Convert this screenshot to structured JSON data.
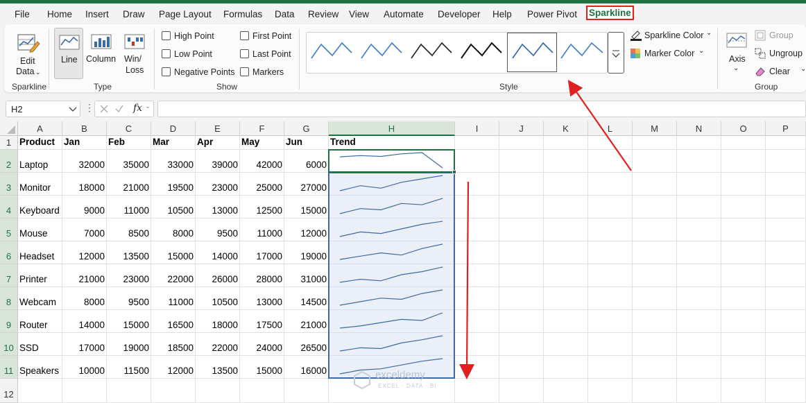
{
  "menu": {
    "tabs": [
      "File",
      "Home",
      "Insert",
      "Draw",
      "Page Layout",
      "Formulas",
      "Data",
      "Review",
      "View",
      "Automate",
      "Developer",
      "Help",
      "Power Pivot",
      "Sparkline"
    ],
    "active_tab": "Sparkline"
  },
  "ribbon": {
    "sparkline_group": {
      "label": "Sparkline",
      "edit_data_line1": "Edit",
      "edit_data_line2": "Data"
    },
    "type_group": {
      "label": "Type",
      "line": "Line",
      "column": "Column",
      "winloss_line1": "Win/",
      "winloss_line2": "Loss"
    },
    "show_group": {
      "label": "Show",
      "high_point": "High Point",
      "low_point": "Low Point",
      "negative_points": "Negative Points",
      "first_point": "First Point",
      "last_point": "Last Point",
      "markers": "Markers"
    },
    "style_group": {
      "label": "Style"
    },
    "color_group": {
      "sparkline_color": "Sparkline Color",
      "marker_color": "Marker Color"
    },
    "group_group": {
      "label": "Group",
      "axis": "Axis",
      "group": "Group",
      "ungroup": "Ungroup",
      "clear": "Clear"
    }
  },
  "formula_bar": {
    "name_box": "H2",
    "fx": "fx",
    "formula": ""
  },
  "sheet": {
    "columns": [
      "A",
      "B",
      "C",
      "D",
      "E",
      "F",
      "G",
      "H",
      "I",
      "J",
      "K",
      "L",
      "M",
      "N",
      "O",
      "P"
    ],
    "selected_column": "H",
    "row_numbers": [
      "1",
      "2",
      "3",
      "4",
      "5",
      "6",
      "7",
      "8",
      "9",
      "10",
      "11",
      "12"
    ],
    "headers": [
      "Product",
      "Jan",
      "Feb",
      "Mar",
      "Apr",
      "May",
      "Jun",
      "Trend"
    ],
    "rows": [
      {
        "product": "Laptop",
        "values": [
          "32000",
          "35000",
          "33000",
          "39000",
          "42000",
          "6000"
        ]
      },
      {
        "product": "Monitor",
        "values": [
          "18000",
          "21000",
          "19500",
          "23000",
          "25000",
          "27000"
        ]
      },
      {
        "product": "Keyboard",
        "values": [
          "9000",
          "11000",
          "10500",
          "13000",
          "12500",
          "15000"
        ]
      },
      {
        "product": "Mouse",
        "values": [
          "7000",
          "8500",
          "8000",
          "9500",
          "11000",
          "12000"
        ]
      },
      {
        "product": "Headset",
        "values": [
          "12000",
          "13500",
          "15000",
          "14000",
          "17000",
          "19000"
        ]
      },
      {
        "product": "Printer",
        "values": [
          "21000",
          "23000",
          "22000",
          "26000",
          "28000",
          "31000"
        ]
      },
      {
        "product": "Webcam",
        "values": [
          "8000",
          "9500",
          "11000",
          "10500",
          "13000",
          "14500"
        ]
      },
      {
        "product": "Router",
        "values": [
          "14000",
          "15000",
          "16500",
          "18000",
          "17500",
          "21000"
        ]
      },
      {
        "product": "SSD",
        "values": [
          "17000",
          "19000",
          "18500",
          "22000",
          "24000",
          "26500"
        ]
      },
      {
        "product": "Speakers",
        "values": [
          "10000",
          "11500",
          "12000",
          "13500",
          "15000",
          "16000"
        ]
      }
    ]
  },
  "watermark": {
    "name": "exceldemy",
    "tagline": "EXCEL · DATA · BI"
  },
  "colors": {
    "accent": "#1e7145",
    "sparkline": "#3b6aa6",
    "annotation": "#e02020"
  },
  "icons": [
    "edit-data-icon",
    "line-sparkline-icon",
    "column-sparkline-icon",
    "winloss-sparkline-icon",
    "sparkline-color-icon",
    "marker-color-icon",
    "axis-icon",
    "group-icon",
    "ungroup-icon",
    "clear-icon",
    "chevron-down-icon"
  ]
}
